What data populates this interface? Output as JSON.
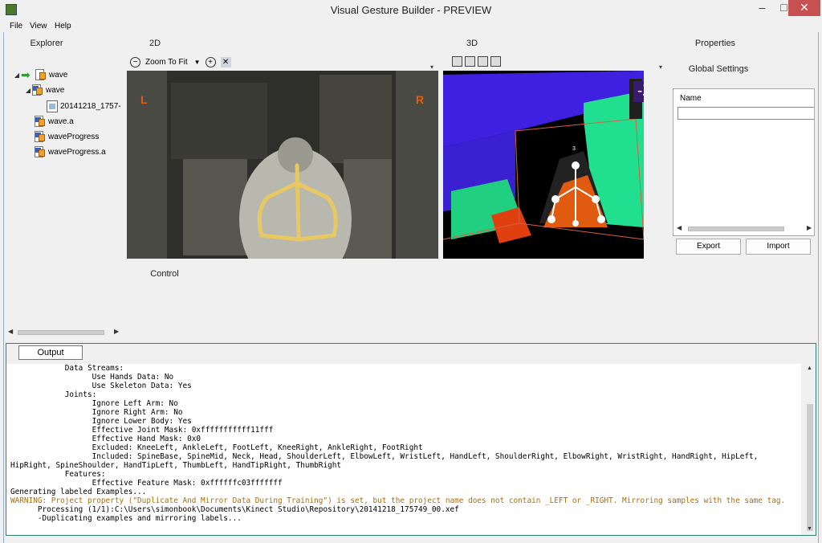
{
  "window": {
    "title": "Visual Gesture Builder - PREVIEW"
  },
  "menu": [
    "File",
    "View",
    "Help"
  ],
  "explorer": {
    "tab": "Explorer",
    "items": [
      {
        "label": "wave",
        "depth": 0,
        "icon": "gesture-project-icon",
        "selected": true
      },
      {
        "label": "wave",
        "depth": 1,
        "icon": "gesture-icon"
      },
      {
        "label": "20141218_1757-",
        "depth": 2,
        "icon": "clip-icon"
      },
      {
        "label": "wave.a",
        "depth": 1,
        "icon": "gesture-icon"
      },
      {
        "label": "waveProgress",
        "depth": 1,
        "icon": "gesture-icon"
      },
      {
        "label": "waveProgress.a",
        "depth": 1,
        "icon": "gesture-icon"
      }
    ]
  },
  "view2d": {
    "tab": "2D",
    "zoom_label": "Zoom To Fit",
    "left_marker": "L",
    "right_marker": "R"
  },
  "view3d": {
    "tab": "3D",
    "axis_label": "-Z",
    "axis_tick": "3"
  },
  "control": {
    "tab": "Control"
  },
  "properties": {
    "tab": "Properties",
    "subtab": "Global Settings",
    "column": "Name",
    "export_label": "Export",
    "import_label": "Import"
  },
  "output": {
    "tab": "Output",
    "lines": [
      {
        "text": "            Data Streams:",
        "warn": false
      },
      {
        "text": "                  Use Hands Data: No",
        "warn": false
      },
      {
        "text": "                  Use Skeleton Data: Yes",
        "warn": false
      },
      {
        "text": "            Joints:",
        "warn": false
      },
      {
        "text": "                  Ignore Left Arm: No",
        "warn": false
      },
      {
        "text": "                  Ignore Right Arm: No",
        "warn": false
      },
      {
        "text": "                  Ignore Lower Body: Yes",
        "warn": false
      },
      {
        "text": "                  Effective Joint Mask: 0xfffffffffff11fff",
        "warn": false
      },
      {
        "text": "                  Effective Hand Mask: 0x0",
        "warn": false
      },
      {
        "text": "                  Excluded: KneeLeft, AnkleLeft, FootLeft, KneeRight, AnkleRight, FootRight",
        "warn": false
      },
      {
        "text": "                  Included: SpineBase, SpineMid, Neck, Head, ShoulderLeft, ElbowLeft, WristLeft, HandLeft, ShoulderRight, ElbowRight, WristRight, HandRight, HipLeft,",
        "warn": false
      },
      {
        "text": "HipRight, SpineShoulder, HandTipLeft, ThumbLeft, HandTipRight, ThumbRight",
        "warn": false
      },
      {
        "text": "            Features:",
        "warn": false
      },
      {
        "text": "                  Effective Feature Mask: 0xffffffc03fffffff",
        "warn": false
      },
      {
        "text": "Generating labeled Examples...",
        "warn": false
      },
      {
        "text": "WARNING: Project property (\"Duplicate And Mirror Data During Training\") is set, but the project name does not contain _LEFT or _RIGHT. Mirroring samples with the same tag.",
        "warn": true
      },
      {
        "text": "      Processing (1/1):C:\\Users\\simonbook\\Documents\\Kinect Studio\\Repository\\20141218_175749_00.xef",
        "warn": false
      },
      {
        "text": "      -Duplicating examples and mirroring labels...",
        "warn": false
      }
    ]
  },
  "colors": {
    "output_border": "#2f7f6f",
    "warning_text": "#b06e00",
    "close_button": "#c75050",
    "skeleton": "#e8c860"
  }
}
